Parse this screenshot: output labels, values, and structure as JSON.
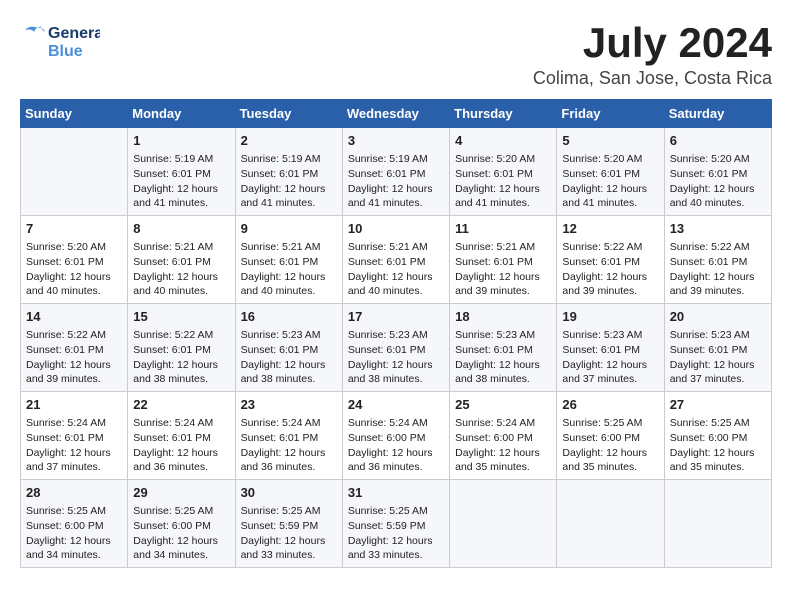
{
  "header": {
    "logo_top": "General",
    "logo_bottom": "Blue",
    "month": "July 2024",
    "location": "Colima, San Jose, Costa Rica"
  },
  "days_of_week": [
    "Sunday",
    "Monday",
    "Tuesday",
    "Wednesday",
    "Thursday",
    "Friday",
    "Saturday"
  ],
  "weeks": [
    [
      {
        "day": "",
        "info": ""
      },
      {
        "day": "1",
        "info": "Sunrise: 5:19 AM\nSunset: 6:01 PM\nDaylight: 12 hours\nand 41 minutes."
      },
      {
        "day": "2",
        "info": "Sunrise: 5:19 AM\nSunset: 6:01 PM\nDaylight: 12 hours\nand 41 minutes."
      },
      {
        "day": "3",
        "info": "Sunrise: 5:19 AM\nSunset: 6:01 PM\nDaylight: 12 hours\nand 41 minutes."
      },
      {
        "day": "4",
        "info": "Sunrise: 5:20 AM\nSunset: 6:01 PM\nDaylight: 12 hours\nand 41 minutes."
      },
      {
        "day": "5",
        "info": "Sunrise: 5:20 AM\nSunset: 6:01 PM\nDaylight: 12 hours\nand 41 minutes."
      },
      {
        "day": "6",
        "info": "Sunrise: 5:20 AM\nSunset: 6:01 PM\nDaylight: 12 hours\nand 40 minutes."
      }
    ],
    [
      {
        "day": "7",
        "info": "Sunrise: 5:20 AM\nSunset: 6:01 PM\nDaylight: 12 hours\nand 40 minutes."
      },
      {
        "day": "8",
        "info": "Sunrise: 5:21 AM\nSunset: 6:01 PM\nDaylight: 12 hours\nand 40 minutes."
      },
      {
        "day": "9",
        "info": "Sunrise: 5:21 AM\nSunset: 6:01 PM\nDaylight: 12 hours\nand 40 minutes."
      },
      {
        "day": "10",
        "info": "Sunrise: 5:21 AM\nSunset: 6:01 PM\nDaylight: 12 hours\nand 40 minutes."
      },
      {
        "day": "11",
        "info": "Sunrise: 5:21 AM\nSunset: 6:01 PM\nDaylight: 12 hours\nand 39 minutes."
      },
      {
        "day": "12",
        "info": "Sunrise: 5:22 AM\nSunset: 6:01 PM\nDaylight: 12 hours\nand 39 minutes."
      },
      {
        "day": "13",
        "info": "Sunrise: 5:22 AM\nSunset: 6:01 PM\nDaylight: 12 hours\nand 39 minutes."
      }
    ],
    [
      {
        "day": "14",
        "info": "Sunrise: 5:22 AM\nSunset: 6:01 PM\nDaylight: 12 hours\nand 39 minutes."
      },
      {
        "day": "15",
        "info": "Sunrise: 5:22 AM\nSunset: 6:01 PM\nDaylight: 12 hours\nand 38 minutes."
      },
      {
        "day": "16",
        "info": "Sunrise: 5:23 AM\nSunset: 6:01 PM\nDaylight: 12 hours\nand 38 minutes."
      },
      {
        "day": "17",
        "info": "Sunrise: 5:23 AM\nSunset: 6:01 PM\nDaylight: 12 hours\nand 38 minutes."
      },
      {
        "day": "18",
        "info": "Sunrise: 5:23 AM\nSunset: 6:01 PM\nDaylight: 12 hours\nand 38 minutes."
      },
      {
        "day": "19",
        "info": "Sunrise: 5:23 AM\nSunset: 6:01 PM\nDaylight: 12 hours\nand 37 minutes."
      },
      {
        "day": "20",
        "info": "Sunrise: 5:23 AM\nSunset: 6:01 PM\nDaylight: 12 hours\nand 37 minutes."
      }
    ],
    [
      {
        "day": "21",
        "info": "Sunrise: 5:24 AM\nSunset: 6:01 PM\nDaylight: 12 hours\nand 37 minutes."
      },
      {
        "day": "22",
        "info": "Sunrise: 5:24 AM\nSunset: 6:01 PM\nDaylight: 12 hours\nand 36 minutes."
      },
      {
        "day": "23",
        "info": "Sunrise: 5:24 AM\nSunset: 6:01 PM\nDaylight: 12 hours\nand 36 minutes."
      },
      {
        "day": "24",
        "info": "Sunrise: 5:24 AM\nSunset: 6:00 PM\nDaylight: 12 hours\nand 36 minutes."
      },
      {
        "day": "25",
        "info": "Sunrise: 5:24 AM\nSunset: 6:00 PM\nDaylight: 12 hours\nand 35 minutes."
      },
      {
        "day": "26",
        "info": "Sunrise: 5:25 AM\nSunset: 6:00 PM\nDaylight: 12 hours\nand 35 minutes."
      },
      {
        "day": "27",
        "info": "Sunrise: 5:25 AM\nSunset: 6:00 PM\nDaylight: 12 hours\nand 35 minutes."
      }
    ],
    [
      {
        "day": "28",
        "info": "Sunrise: 5:25 AM\nSunset: 6:00 PM\nDaylight: 12 hours\nand 34 minutes."
      },
      {
        "day": "29",
        "info": "Sunrise: 5:25 AM\nSunset: 6:00 PM\nDaylight: 12 hours\nand 34 minutes."
      },
      {
        "day": "30",
        "info": "Sunrise: 5:25 AM\nSunset: 5:59 PM\nDaylight: 12 hours\nand 33 minutes."
      },
      {
        "day": "31",
        "info": "Sunrise: 5:25 AM\nSunset: 5:59 PM\nDaylight: 12 hours\nand 33 minutes."
      },
      {
        "day": "",
        "info": ""
      },
      {
        "day": "",
        "info": ""
      },
      {
        "day": "",
        "info": ""
      }
    ]
  ]
}
